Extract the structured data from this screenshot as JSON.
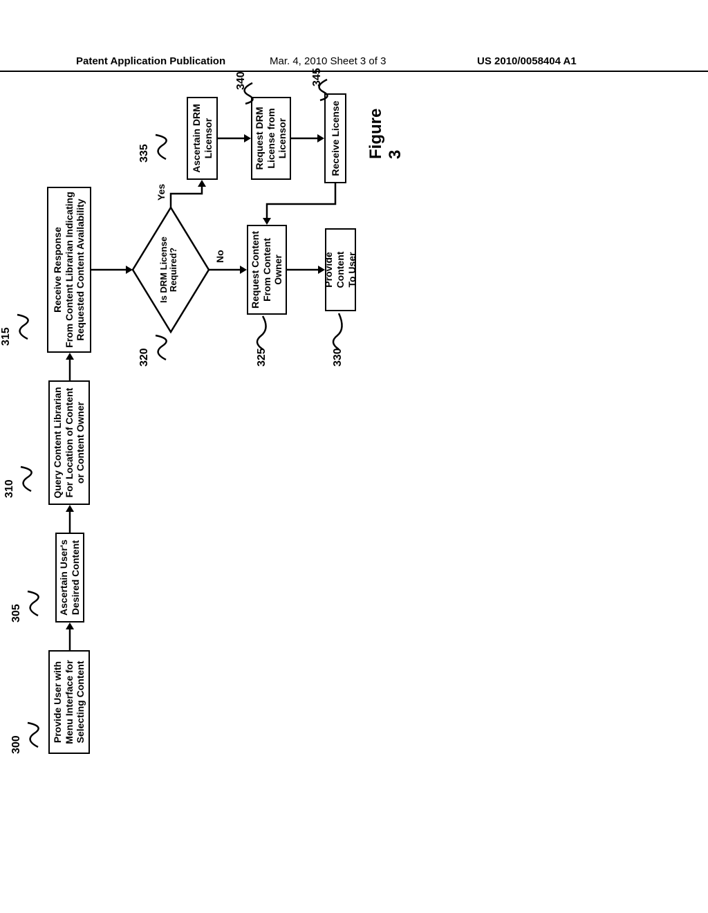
{
  "header": {
    "left": "Patent Application Publication",
    "center": "Mar. 4, 2010  Sheet 3 of 3",
    "right": "US 2010/0058404 A1"
  },
  "boxes": {
    "b300": "Provide User with\nMenu Interface for\nSelecting Content",
    "b305": "Ascertain User's\nDesired Content",
    "b310": "Query Content Librarian\nFor Location of Content\nor Content Owner",
    "b315": "Receive Response\nFrom Content Librarian Indicating\nRequested Content Availability",
    "b320": "Is DRM License\nRequired?",
    "b325": "Request Content\nFrom Content\nOwner",
    "b330": "Provide Content\nTo User",
    "b335": "Ascertain DRM\nLicensor",
    "b340": "Request DRM\nLicense from\nLicensor",
    "b345": "Receive License"
  },
  "refs": {
    "r300": "300",
    "r305": "305",
    "r310": "310",
    "r315": "315",
    "r320": "320",
    "r325": "325",
    "r330": "330",
    "r335": "335",
    "r340": "340",
    "r345": "345"
  },
  "labels": {
    "yes": "Yes",
    "no": "No",
    "figure": "Figure 3"
  }
}
